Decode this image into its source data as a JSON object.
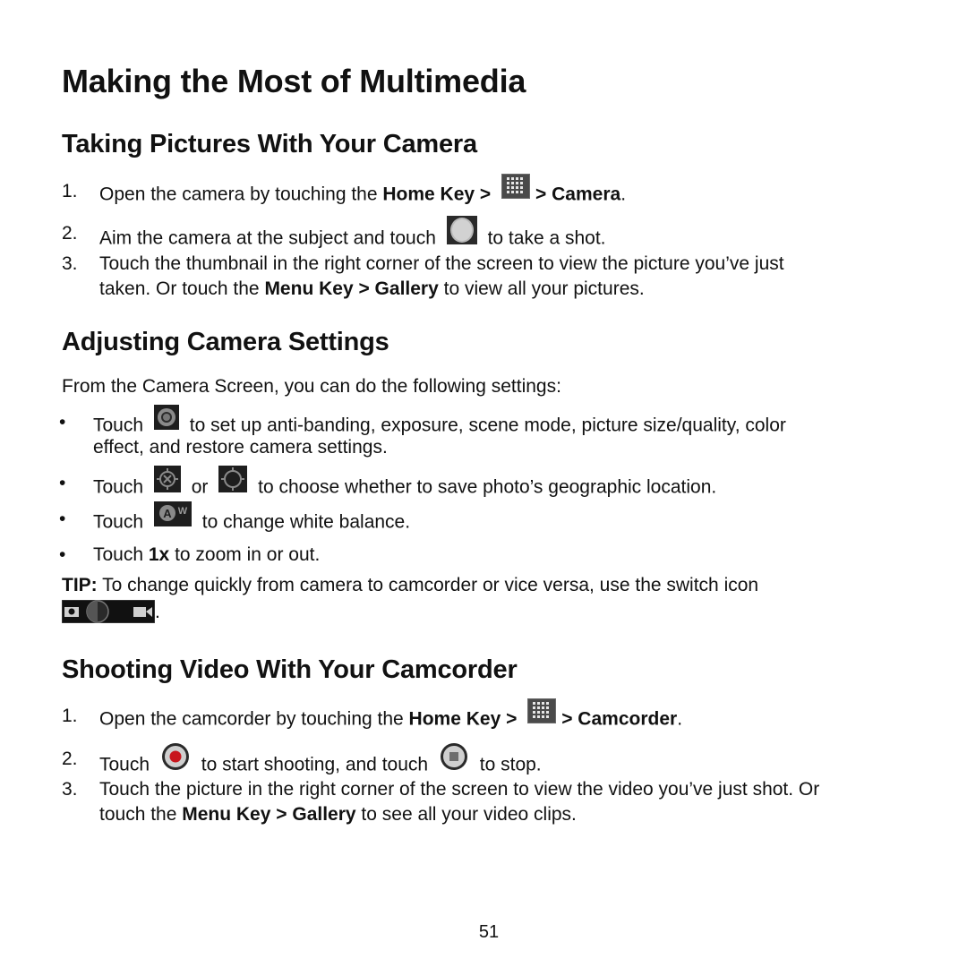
{
  "title": "Making the Most of Multimedia",
  "sections": {
    "camera": {
      "heading": "Taking Pictures With Your Camera",
      "steps": [
        {
          "num": "1.",
          "pre": "Open the camera by touching the ",
          "b1": "Home Key >",
          "icon": "app-grid-icon",
          "b2": "> Camera",
          "post": "."
        },
        {
          "num": "2.",
          "pre": "Aim the camera at the subject and touch",
          "icon": "shutter-icon",
          "post": "to take a shot."
        },
        {
          "num": "3.",
          "line1": "Touch the thumbnail in the right corner of the screen to view the picture you’ve just",
          "pre": "taken. Or touch the ",
          "b1": "Menu Key > Gallery",
          "post": " to view all your pictures."
        }
      ]
    },
    "settings": {
      "heading": "Adjusting Camera Settings",
      "intro": "From the Camera Screen, you can do the following settings:",
      "bullets": [
        {
          "pre": "Touch",
          "icon": "camera-settings-icon",
          "post": "to set up anti-banding, exposure, scene mode, picture size/quality, color",
          "line2": "effect, and restore camera settings."
        },
        {
          "pre": "Touch",
          "icon": "geotag-off-icon",
          "mid": "or",
          "icon2": "geotag-on-icon",
          "post": "to choose whether to save photo’s geographic location."
        },
        {
          "pre": "Touch",
          "icon": "white-balance-icon",
          "post": "to change white balance."
        },
        {
          "pre": "Touch ",
          "b1": "1x",
          "post": " to zoom in or out."
        }
      ],
      "tip_label": "TIP:",
      "tip_text": " To change quickly from camera to camcorder or vice versa, use the switch icon",
      "tip_end": "."
    },
    "video": {
      "heading": "Shooting Video With Your Camcorder",
      "steps": [
        {
          "num": "1.",
          "pre": "Open the camcorder by touching the ",
          "b1": "Home Key >",
          "icon": "app-grid-icon",
          "b2": "> Camcorder",
          "post": "."
        },
        {
          "num": "2.",
          "pre": "Touch",
          "icon": "record-icon",
          "mid": "to start shooting, and touch",
          "icon2": "stop-icon",
          "post": "to stop."
        },
        {
          "num": "3.",
          "line1": "Touch the picture in the right corner of the screen to view the video you’ve just shot. Or",
          "pre": "touch the ",
          "b1": "Menu Key > Gallery",
          "post": " to see all your video clips."
        }
      ]
    }
  },
  "page_number": "51"
}
